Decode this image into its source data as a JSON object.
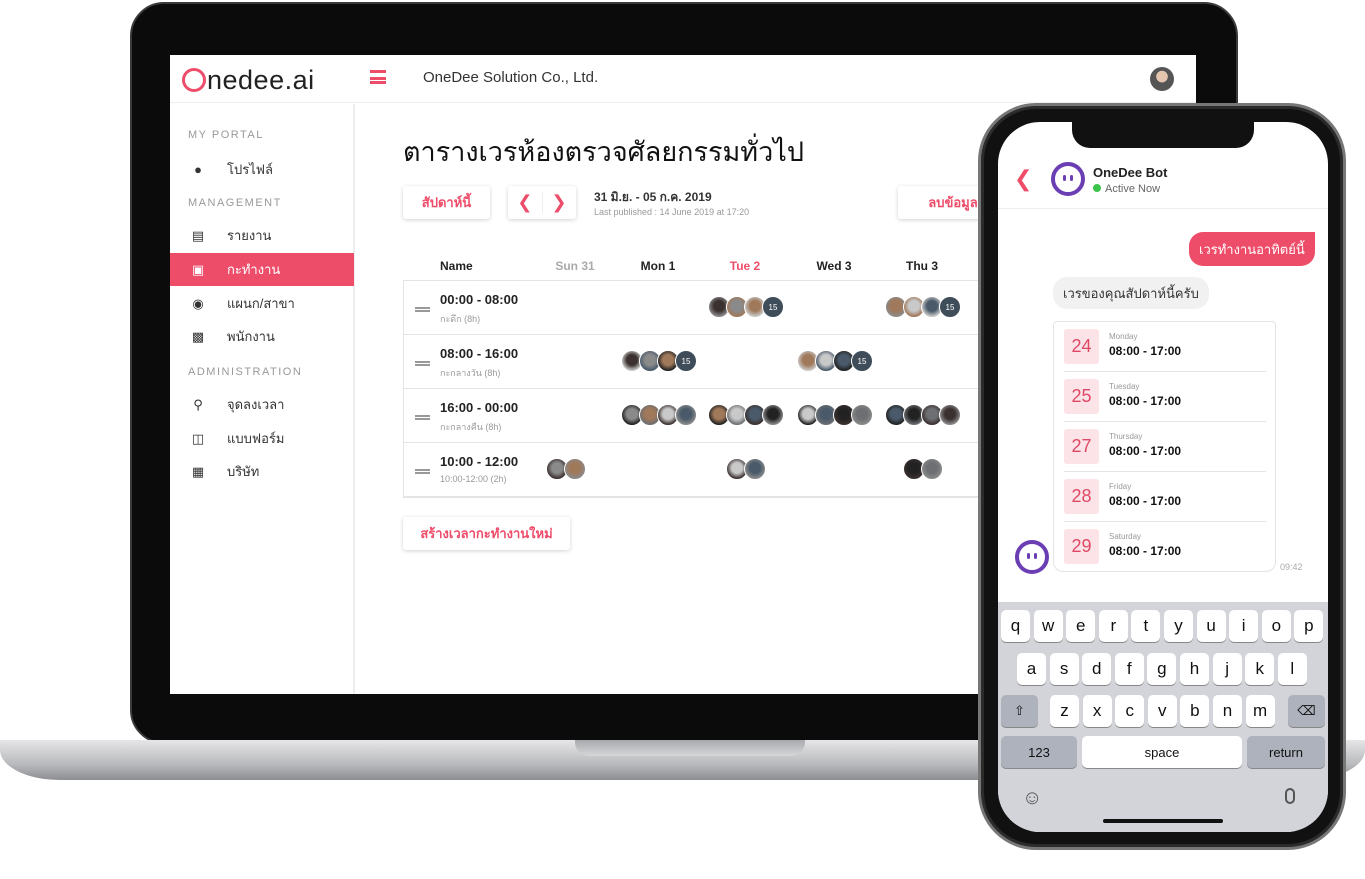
{
  "brand": {
    "logo_text": "nedee.ai",
    "accent": "#ee4d6a",
    "company": "OneDee Solution Co., Ltd."
  },
  "sidebar": {
    "sections": [
      {
        "label": "MY PORTAL"
      },
      {
        "label": "MANAGEMENT"
      },
      {
        "label": "ADMINISTRATION"
      }
    ],
    "items": [
      {
        "label": "โปรไฟล์",
        "icon": "user-circle-icon"
      },
      {
        "label": "รายงาน",
        "icon": "document-icon"
      },
      {
        "label": "กะทำงาน",
        "icon": "shift-icon",
        "active": true
      },
      {
        "label": "แผนก/สาขา",
        "icon": "users-icon"
      },
      {
        "label": "พนักงาน",
        "icon": "id-card-icon"
      },
      {
        "label": "จุดลงเวลา",
        "icon": "pin-icon"
      },
      {
        "label": "แบบฟอร์ม",
        "icon": "clipboard-icon"
      },
      {
        "label": "บริษัท",
        "icon": "building-icon"
      }
    ]
  },
  "main": {
    "title": "ตารางเวรห้องตรวจศัลยกรรมทั่วไป",
    "this_week": "สัปดาห์นี้",
    "date_range": "31 มิ.ย. - 05 ก.ค. 2019",
    "last_published": "Last published : 14 June 2019 at 17:20",
    "delete": "ลบข้อมูล",
    "create": "สร้างเวลากะทำงานใหม่",
    "columns": [
      "Name",
      "Sun 31",
      "Mon 1",
      "Tue 2",
      "Wed 3",
      "Thu 3"
    ],
    "rows": [
      {
        "time": "00:00 - 08:00",
        "sub": "กะดึก (8h)",
        "days": [
          0,
          0,
          3,
          0,
          3
        ],
        "badge": "15"
      },
      {
        "time": "08:00 - 16:00",
        "sub": "กะกลางวัน (8h)",
        "days": [
          0,
          3,
          0,
          3,
          0
        ],
        "badge": "15"
      },
      {
        "time": "16:00 - 00:00",
        "sub": "กะกลางคืน (8h)",
        "days": [
          0,
          4,
          4,
          4,
          4
        ],
        "badge": ""
      },
      {
        "time": "10:00 - 12:00",
        "sub": "10:00-12:00 (2h)",
        "days": [
          2,
          0,
          2,
          0,
          2
        ],
        "badge": ""
      }
    ]
  },
  "phone": {
    "bot_name": "OneDee Bot",
    "status": "Active Now",
    "sent": "เวรทำงานอาทิตย์นี้",
    "reply": "เวรของคุณสัปดาห์นี้ครับ",
    "shifts": [
      {
        "day": "24",
        "name": "Monday",
        "time": "08:00 - 17:00"
      },
      {
        "day": "25",
        "name": "Tuesday",
        "time": "08:00 - 17:00"
      },
      {
        "day": "27",
        "name": "Thursday",
        "time": "08:00 - 17:00"
      },
      {
        "day": "28",
        "name": "Friday",
        "time": "08:00 - 17:00"
      },
      {
        "day": "29",
        "name": "Saturday",
        "time": "08:00 - 17:00"
      }
    ],
    "timestamp": "09:42",
    "keyboard": {
      "row1": [
        "q",
        "w",
        "e",
        "r",
        "t",
        "y",
        "u",
        "i",
        "o",
        "p"
      ],
      "row2": [
        "a",
        "s",
        "d",
        "f",
        "g",
        "h",
        "j",
        "k",
        "l"
      ],
      "row3": [
        "z",
        "x",
        "c",
        "v",
        "b",
        "n",
        "m"
      ],
      "numbers": "123",
      "space": "space",
      "return": "return"
    }
  }
}
